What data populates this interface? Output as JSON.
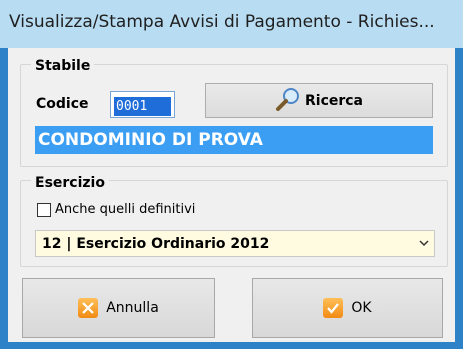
{
  "window": {
    "title": "Visualizza/Stampa Avvisi di Pagamento - Richies..."
  },
  "stabile": {
    "group_label": "Stabile",
    "codice_label": "Codice",
    "codice_value": "0001",
    "ricerca_label": "Ricerca",
    "condominio_name": "CONDOMINIO DI PROVA"
  },
  "esercizio": {
    "group_label": "Esercizio",
    "checkbox_label": "Anche quelli definitivi",
    "checkbox_checked": false,
    "selected": "12 | Esercizio Ordinario 2012"
  },
  "buttons": {
    "annulla": "Annulla",
    "ok": "OK"
  },
  "icons": {
    "search": "magnifier-icon",
    "cancel": "x-icon",
    "ok": "checkmark-icon",
    "dropdown": "chevron-down-icon"
  },
  "colors": {
    "title_bg": "#b8dcf2",
    "frame": "#2e82c7",
    "selection": "#3b9ef3",
    "select_bg": "#fffbe0",
    "icon_orange": "#f28b14"
  }
}
